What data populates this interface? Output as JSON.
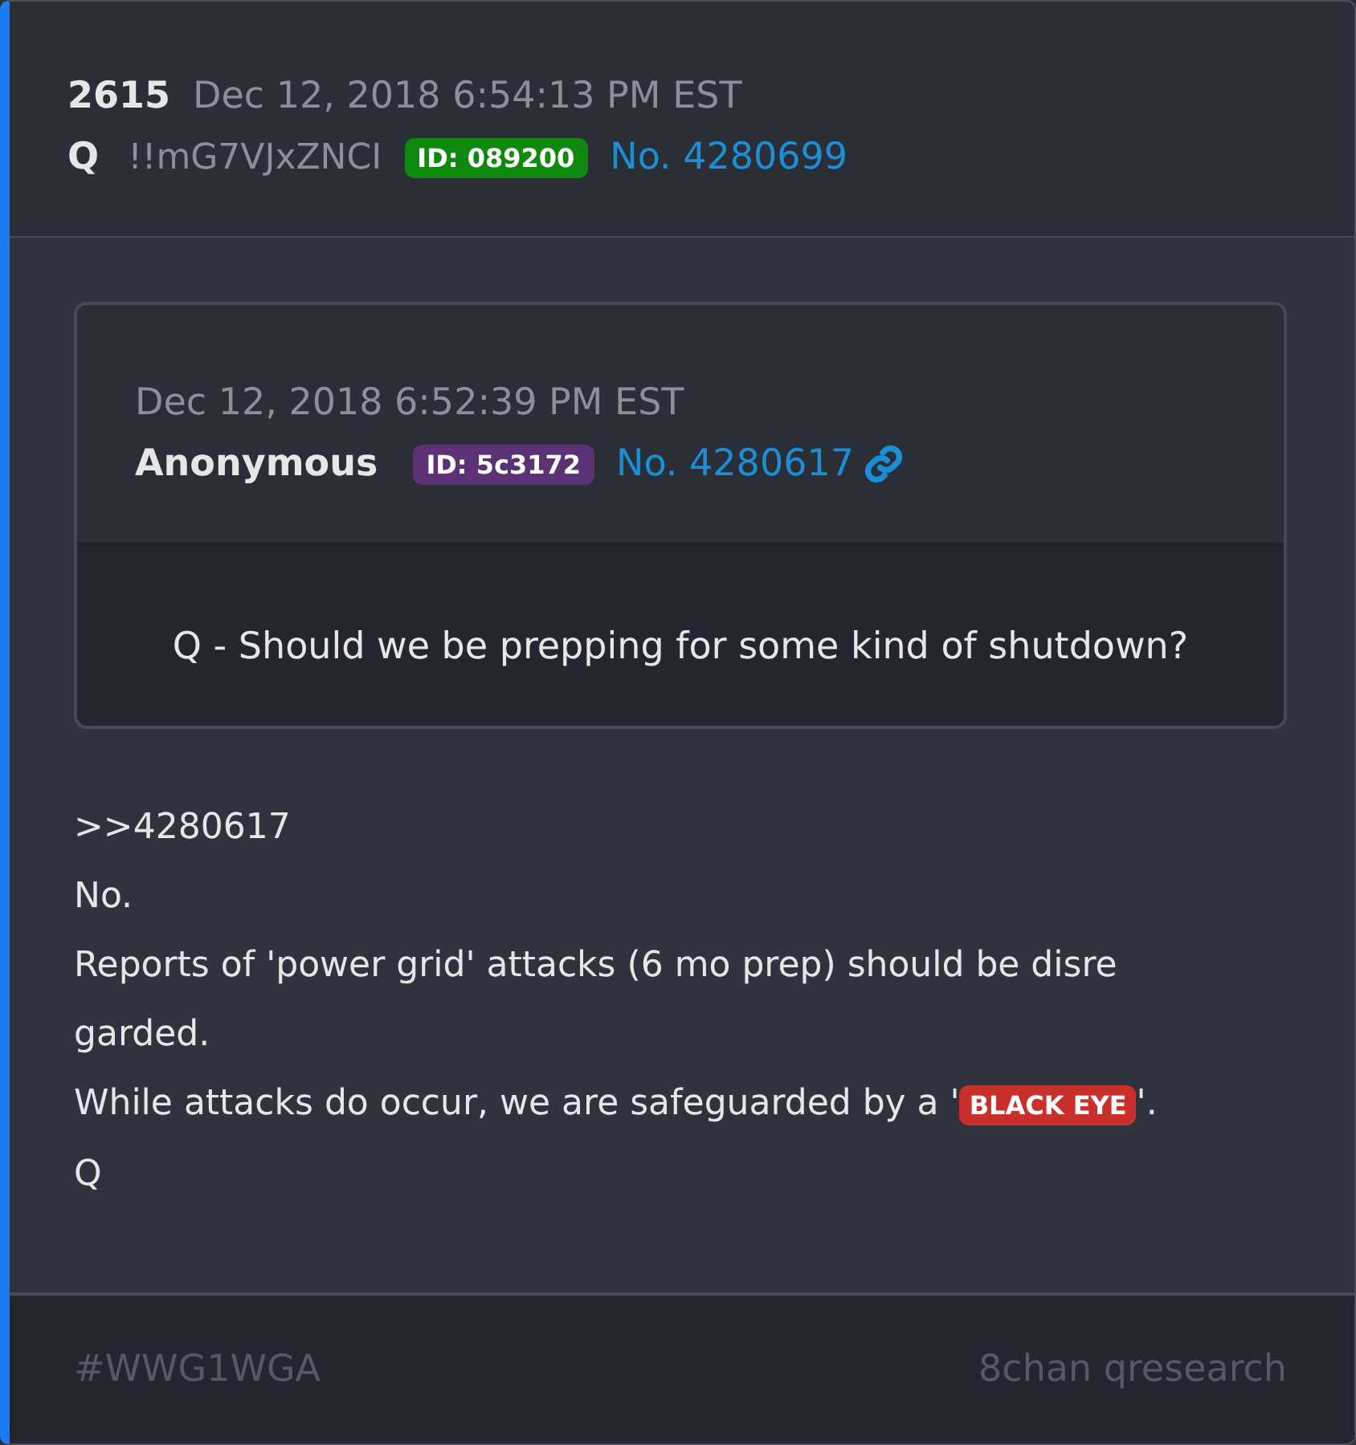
{
  "post": {
    "number": "2615",
    "date": "Dec 12, 2018 6:54:13 PM EST",
    "author": "Q",
    "tripcode": "!!mG7VJxZNCI",
    "id_badge": {
      "label": "ID: 089200",
      "color": "#108a0e"
    },
    "post_link": "No. 4280699"
  },
  "quoted_post": {
    "date": "Dec 12, 2018 6:52:39 PM EST",
    "author": "Anonymous",
    "id_badge": {
      "label": "ID: 5c3172",
      "color": "#5b3276"
    },
    "post_link": "No. 4280617",
    "body": "Q - Should we be prepping for some kind of shutdown?"
  },
  "body_lines": [
    [
      {
        "kind": "text",
        "text": ">>4280617"
      }
    ],
    [
      {
        "kind": "text",
        "text": "No."
      }
    ],
    [
      {
        "kind": "text",
        "text": "Reports of 'power grid' attacks (6 mo prep) should be disre"
      }
    ],
    [
      {
        "kind": "text",
        "text": "garded."
      }
    ],
    [
      {
        "kind": "text",
        "text": "While attacks do occur, we are safeguarded by a '"
      },
      {
        "kind": "highlight",
        "text": "BLACK EYE"
      },
      {
        "kind": "text",
        "text": "'."
      }
    ],
    [
      {
        "kind": "text",
        "text": "Q"
      }
    ]
  ],
  "footer": {
    "hashtag": "#WWG1WGA",
    "source": "8chan qresearch"
  }
}
